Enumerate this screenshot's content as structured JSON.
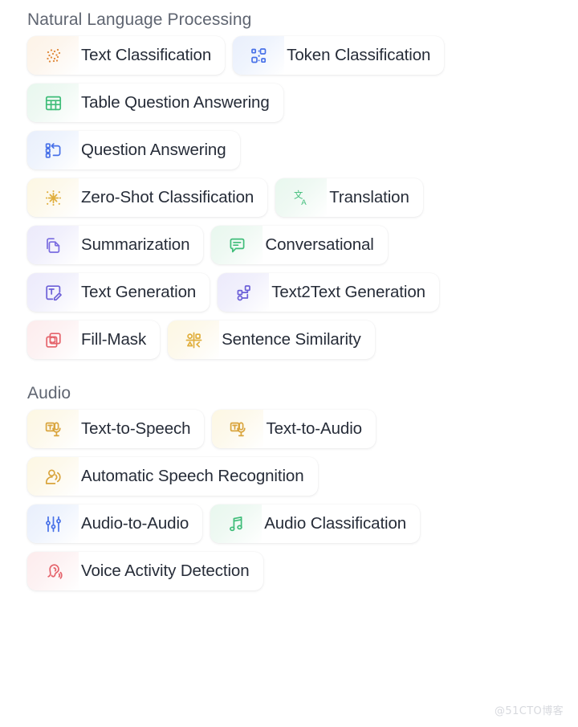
{
  "watermark": "@51CTO博客",
  "sections": [
    {
      "title": "Natural Language Processing",
      "rows": [
        [
          {
            "label": "Text Classification",
            "icon": "scatter-dots-icon",
            "color": "#e08a3c",
            "tint": "orange"
          },
          {
            "label": "Token Classification",
            "icon": "node-graph-icon",
            "color": "#4871e8",
            "tint": "blue"
          }
        ],
        [
          {
            "label": "Table Question Answering",
            "icon": "table-grid-icon",
            "color": "#3fbd79",
            "tint": "green"
          }
        ],
        [
          {
            "label": "Question Answering",
            "icon": "list-reply-icon",
            "color": "#4871e8",
            "tint": "blue"
          }
        ],
        [
          {
            "label": "Zero-Shot Classification",
            "icon": "burst-cross-icon",
            "color": "#e0ae3c",
            "tint": "yellow"
          },
          {
            "label": "Translation",
            "icon": "translate-icon",
            "color": "#3fbd79",
            "tint": "green"
          }
        ],
        [
          {
            "label": "Summarization",
            "icon": "copy-document-icon",
            "color": "#7a6ce0",
            "tint": "indigo"
          },
          {
            "label": "Conversational",
            "icon": "chat-bubble-icon",
            "color": "#3fbd79",
            "tint": "green"
          }
        ],
        [
          {
            "label": "Text Generation",
            "icon": "text-edit-icon",
            "color": "#6c5fd8",
            "tint": "indigo"
          },
          {
            "label": "Text2Text Generation",
            "icon": "flow-nodes-icon",
            "color": "#6c5fd8",
            "tint": "indigo"
          }
        ],
        [
          {
            "label": "Fill-Mask",
            "icon": "overlap-squares-icon",
            "color": "#e5636b",
            "tint": "red"
          },
          {
            "label": "Sentence Similarity",
            "icon": "quadrant-shapes-icon",
            "color": "#e0ae3c",
            "tint": "yellow"
          }
        ]
      ]
    },
    {
      "title": "Audio",
      "rows": [
        [
          {
            "label": "Text-to-Speech",
            "icon": "text-microphone-icon",
            "color": "#d9a43c",
            "tint": "yellow"
          },
          {
            "label": "Text-to-Audio",
            "icon": "text-microphone-icon",
            "color": "#d9a43c",
            "tint": "yellow"
          }
        ],
        [
          {
            "label": "Automatic Speech Recognition",
            "icon": "person-speaking-icon",
            "color": "#d9a43c",
            "tint": "yellow"
          }
        ],
        [
          {
            "label": "Audio-to-Audio",
            "icon": "sliders-icon",
            "color": "#4871e8",
            "tint": "blue"
          },
          {
            "label": "Audio Classification",
            "icon": "music-note-icon",
            "color": "#3fbd79",
            "tint": "green"
          }
        ],
        [
          {
            "label": "Voice Activity Detection",
            "icon": "ear-listen-icon",
            "color": "#e5636b",
            "tint": "red"
          }
        ]
      ]
    }
  ]
}
